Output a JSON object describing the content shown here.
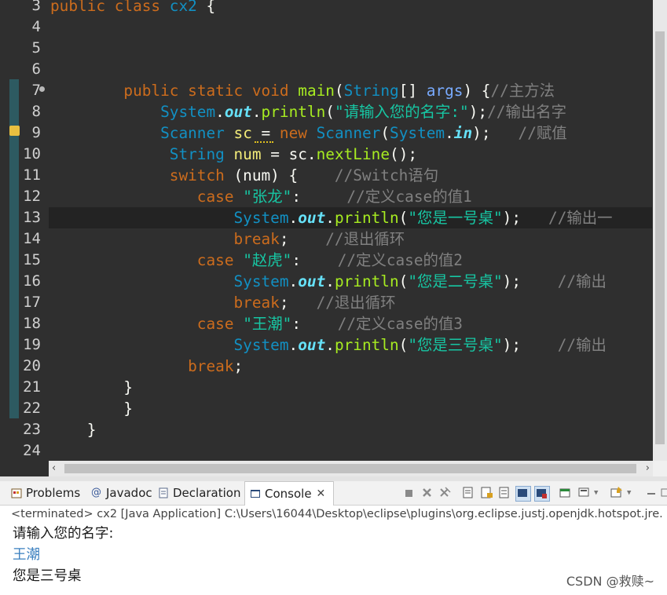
{
  "editor": {
    "lines": [
      {
        "n": "3",
        "parts": [
          {
            "c": "kw",
            "t": "public"
          },
          {
            "c": "plain",
            "t": " "
          },
          {
            "c": "kw",
            "t": "class"
          },
          {
            "c": "plain",
            "t": " "
          },
          {
            "c": "type",
            "t": "cx2"
          },
          {
            "c": "plain",
            "t": " {"
          }
        ]
      },
      {
        "n": "4",
        "parts": []
      },
      {
        "n": "5",
        "parts": []
      },
      {
        "n": "6",
        "parts": []
      },
      {
        "n": "7",
        "parts": [
          {
            "c": "plain",
            "t": "        "
          },
          {
            "c": "kw",
            "t": "public"
          },
          {
            "c": "plain",
            "t": " "
          },
          {
            "c": "kw",
            "t": "static"
          },
          {
            "c": "plain",
            "t": " "
          },
          {
            "c": "kw",
            "t": "void"
          },
          {
            "c": "plain",
            "t": " "
          },
          {
            "c": "meth",
            "t": "main"
          },
          {
            "c": "plain",
            "t": "("
          },
          {
            "c": "type",
            "t": "String"
          },
          {
            "c": "plain",
            "t": "[] "
          },
          {
            "c": "param",
            "t": "args"
          },
          {
            "c": "plain",
            "t": ") {"
          },
          {
            "c": "cmt",
            "t": "//主方法"
          }
        ]
      },
      {
        "n": "8",
        "parts": [
          {
            "c": "plain",
            "t": "            "
          },
          {
            "c": "type",
            "t": "System"
          },
          {
            "c": "plain",
            "t": "."
          },
          {
            "c": "fld",
            "t": "out"
          },
          {
            "c": "plain",
            "t": "."
          },
          {
            "c": "meth",
            "t": "println"
          },
          {
            "c": "plain",
            "t": "("
          },
          {
            "c": "str",
            "t": "\"请输入您的名字:\""
          },
          {
            "c": "plain",
            "t": ");"
          },
          {
            "c": "cmt",
            "t": "//输出名字"
          }
        ]
      },
      {
        "n": "9",
        "parts": [
          {
            "c": "plain",
            "t": "            "
          },
          {
            "c": "type",
            "t": "Scanner"
          },
          {
            "c": "plain",
            "t": " "
          },
          {
            "c": "var",
            "t": "sc"
          },
          {
            "c": "plain",
            "t": " = "
          },
          {
            "c": "kw",
            "t": "new"
          },
          {
            "c": "plain",
            "t": " "
          },
          {
            "c": "type",
            "t": "Scanner"
          },
          {
            "c": "plain",
            "t": "("
          },
          {
            "c": "type",
            "t": "System"
          },
          {
            "c": "plain",
            "t": "."
          },
          {
            "c": "fld",
            "t": "in"
          },
          {
            "c": "plain",
            "t": ");   "
          },
          {
            "c": "cmt",
            "t": "//赋值"
          }
        ]
      },
      {
        "n": "10",
        "parts": [
          {
            "c": "plain",
            "t": "             "
          },
          {
            "c": "type",
            "t": "String"
          },
          {
            "c": "plain",
            "t": " "
          },
          {
            "c": "var",
            "t": "num"
          },
          {
            "c": "plain",
            "t": " = "
          },
          {
            "c": "plain",
            "t": "sc"
          },
          {
            "c": "plain",
            "t": "."
          },
          {
            "c": "meth",
            "t": "nextLine"
          },
          {
            "c": "plain",
            "t": "();"
          }
        ]
      },
      {
        "n": "11",
        "parts": [
          {
            "c": "plain",
            "t": "             "
          },
          {
            "c": "kw",
            "t": "switch"
          },
          {
            "c": "plain",
            "t": " (num) {    "
          },
          {
            "c": "cmt",
            "t": "//Switch语句"
          }
        ]
      },
      {
        "n": "12",
        "parts": [
          {
            "c": "plain",
            "t": "                "
          },
          {
            "c": "kw",
            "t": "case"
          },
          {
            "c": "plain",
            "t": " "
          },
          {
            "c": "str",
            "t": "\"张龙\""
          },
          {
            "c": "plain",
            "t": ":     "
          },
          {
            "c": "cmt",
            "t": "//定义case的值1"
          }
        ]
      },
      {
        "n": "13",
        "parts": [
          {
            "c": "plain",
            "t": "                    "
          },
          {
            "c": "type",
            "t": "System"
          },
          {
            "c": "plain",
            "t": "."
          },
          {
            "c": "fld",
            "t": "out"
          },
          {
            "c": "plain",
            "t": "."
          },
          {
            "c": "meth",
            "t": "println"
          },
          {
            "c": "plain",
            "t": "("
          },
          {
            "c": "str",
            "t": "\"您是一号桌\""
          },
          {
            "c": "plain",
            "t": ");   "
          },
          {
            "c": "cmt",
            "t": "//输出一"
          }
        ]
      },
      {
        "n": "14",
        "parts": [
          {
            "c": "plain",
            "t": "                    "
          },
          {
            "c": "kw",
            "t": "break"
          },
          {
            "c": "plain",
            "t": ";    "
          },
          {
            "c": "cmt",
            "t": "//退出循环"
          }
        ]
      },
      {
        "n": "15",
        "parts": [
          {
            "c": "plain",
            "t": "                "
          },
          {
            "c": "kw",
            "t": "case"
          },
          {
            "c": "plain",
            "t": " "
          },
          {
            "c": "str",
            "t": "\"赵虎\""
          },
          {
            "c": "plain",
            "t": ":    "
          },
          {
            "c": "cmt",
            "t": "//定义case的值2"
          }
        ]
      },
      {
        "n": "16",
        "parts": [
          {
            "c": "plain",
            "t": "                    "
          },
          {
            "c": "type",
            "t": "System"
          },
          {
            "c": "plain",
            "t": "."
          },
          {
            "c": "fld",
            "t": "out"
          },
          {
            "c": "plain",
            "t": "."
          },
          {
            "c": "meth",
            "t": "println"
          },
          {
            "c": "plain",
            "t": "("
          },
          {
            "c": "str",
            "t": "\"您是二号桌\""
          },
          {
            "c": "plain",
            "t": ");    "
          },
          {
            "c": "cmt",
            "t": "//输出"
          }
        ]
      },
      {
        "n": "17",
        "parts": [
          {
            "c": "plain",
            "t": "                    "
          },
          {
            "c": "kw",
            "t": "break"
          },
          {
            "c": "plain",
            "t": ";   "
          },
          {
            "c": "cmt",
            "t": "//退出循环"
          }
        ]
      },
      {
        "n": "18",
        "parts": [
          {
            "c": "plain",
            "t": "                "
          },
          {
            "c": "kw",
            "t": "case"
          },
          {
            "c": "plain",
            "t": " "
          },
          {
            "c": "str",
            "t": "\"王潮\""
          },
          {
            "c": "plain",
            "t": ":    "
          },
          {
            "c": "cmt",
            "t": "//定义case的值3"
          }
        ]
      },
      {
        "n": "19",
        "parts": [
          {
            "c": "plain",
            "t": "                    "
          },
          {
            "c": "type",
            "t": "System"
          },
          {
            "c": "plain",
            "t": "."
          },
          {
            "c": "fld",
            "t": "out"
          },
          {
            "c": "plain",
            "t": "."
          },
          {
            "c": "meth",
            "t": "println"
          },
          {
            "c": "plain",
            "t": "("
          },
          {
            "c": "str",
            "t": "\"您是三号桌\""
          },
          {
            "c": "plain",
            "t": ");    "
          },
          {
            "c": "cmt",
            "t": "//输出"
          }
        ]
      },
      {
        "n": "20",
        "parts": [
          {
            "c": "plain",
            "t": "               "
          },
          {
            "c": "kw",
            "t": "break"
          },
          {
            "c": "plain",
            "t": ";"
          }
        ]
      },
      {
        "n": "21",
        "parts": [
          {
            "c": "plain",
            "t": "        }"
          }
        ]
      },
      {
        "n": "22",
        "parts": [
          {
            "c": "plain",
            "t": "        }"
          }
        ]
      },
      {
        "n": "23",
        "parts": [
          {
            "c": "plain",
            "t": "    }"
          }
        ]
      },
      {
        "n": "24",
        "parts": []
      }
    ]
  },
  "tabs": [
    {
      "label": "Problems",
      "icon": "problems-icon"
    },
    {
      "label": "Javadoc",
      "icon": "javadoc-icon"
    },
    {
      "label": "Declaration",
      "icon": "declaration-icon"
    },
    {
      "label": "Console",
      "icon": "console-icon",
      "active": true
    }
  ],
  "console": {
    "status": "<terminated> cx2 [Java Application] C:\\Users\\16044\\Desktop\\eclipse\\plugins\\org.eclipse.justj.openjdk.hotspot.jre.",
    "output": [
      {
        "text": "请输入您的名字:",
        "color": "#1a1a1a"
      },
      {
        "text": "王潮",
        "color": "#3a7fbf"
      },
      {
        "text": "您是三号桌",
        "color": "#1a1a1a"
      }
    ]
  },
  "watermark": "CSDN @救赎~"
}
